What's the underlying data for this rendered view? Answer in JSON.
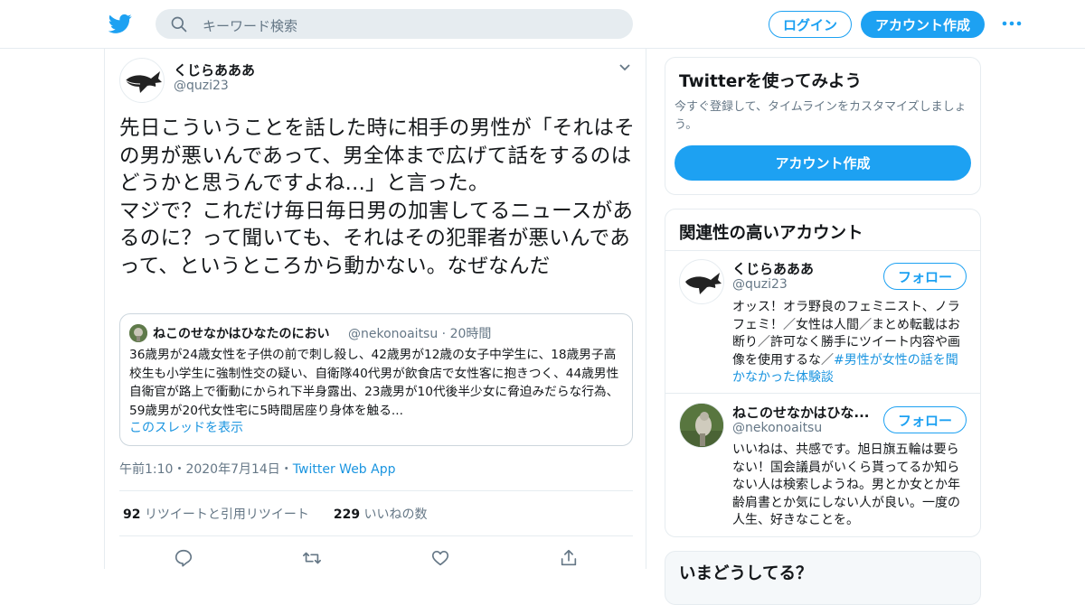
{
  "colors": {
    "accent": "#1da1f2",
    "link": "#1b95e0",
    "muted": "#657786",
    "border": "#e6ecf0"
  },
  "header": {
    "logo_icon": "twitter-bird-icon",
    "search_placeholder": "キーワード検索",
    "login_label": "ログイン",
    "signup_label": "アカウント作成",
    "more_icon": "more-dots-icon"
  },
  "tweet": {
    "author_name": "くじらあああ",
    "author_handle": "@quzi23",
    "text": "先日こういうことを話した時に相手の男性が「それはその男が悪いんであって、男全体まで広げて話をするのはどうかと思うんですよね...」と言った。\nマジで？これだけ毎日毎日男の加害してるニュースがあるのに？って聞いても、それはその犯罪者が悪いんであって、というところから動かない。なぜなんだ",
    "quote": {
      "author_name": "ねこのせなかはひなたのにおい",
      "author_handle": "@nekonoaitsu",
      "time": "20時間",
      "text": "36歳男が24歳女性を子供の前で刺し殺し、42歳男が12歳の女子中学生に、18歳男子高校生も小学生に強制性交の疑い、自衛隊40代男が飲食店で女性客に抱きつく、44歳男性自衛官が路上で衝動にかられ下半身露出、23歳男が10代後半少女に脅迫みだらな行為、59歳男が20代女性宅に5時間居座り身体を触る...",
      "thread_link": "このスレッドを表示"
    },
    "timestamp": "午前1:10・2020年7月14日",
    "source_app": "Twitter Web App",
    "retweets_count": "92",
    "retweets_label": "リツイートと引用リツイート",
    "likes_count": "229",
    "likes_label": "いいねの数",
    "actions": [
      "reply-icon",
      "retweet-icon",
      "like-icon",
      "share-icon"
    ]
  },
  "sidebar": {
    "signup_card": {
      "title": "Twitterを使ってみよう",
      "subtitle": "今すぐ登録して、タイムラインをカスタマイズしましょう。",
      "button_label": "アカウント作成"
    },
    "related": {
      "title": "関連性の高いアカウント",
      "accounts": [
        {
          "name": "くじらあああ",
          "handle": "@quzi23",
          "bio": "オッス！オラ野良のフェミニスト、ノラフェミ！／女性は人間／まとめ転載はお断り／許可なく勝手にツイート内容や画像を使用するな／",
          "bio_tag": "#男性が女性の話を聞かなかった体験談",
          "follow_label": "フォロー"
        },
        {
          "name": "ねこのせなかはひな...",
          "handle": "@nekonoaitsu",
          "bio": "いいねは、共感です。旭日旗五輪は要らない！国会議員がいくら貰ってるか知らない人は検索しようね。男とか女とか年齢肩書とか気にしない人が良い。一度の人生、好きなことを。",
          "follow_label": "フォロー"
        }
      ]
    },
    "next_card_title": "いまどうしてる？"
  }
}
